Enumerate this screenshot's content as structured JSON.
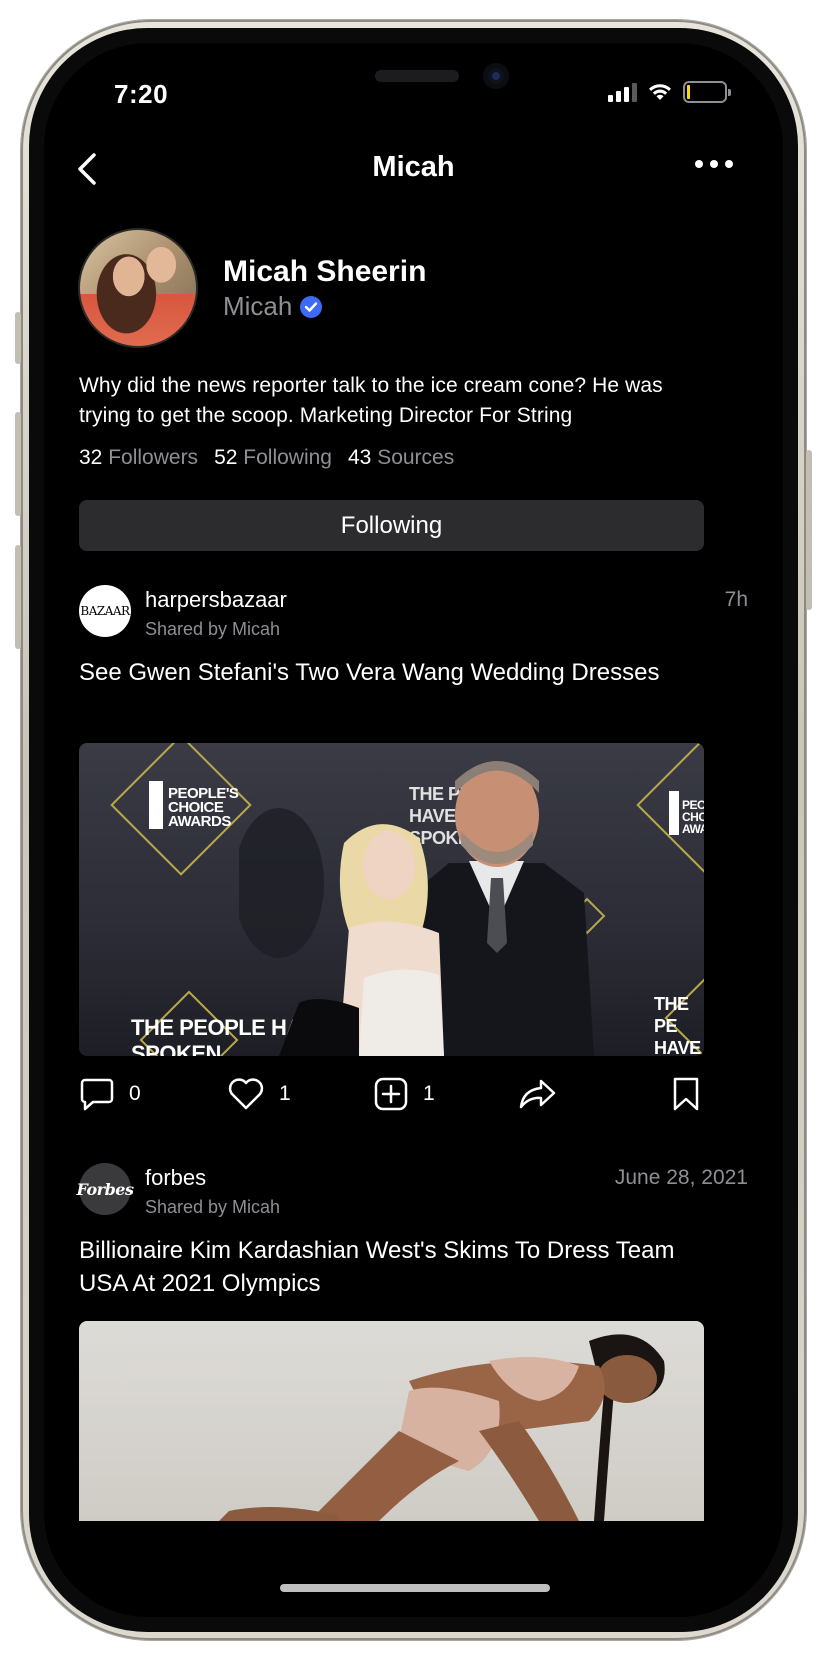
{
  "status_bar": {
    "time": "7:20"
  },
  "nav": {
    "title": "Micah"
  },
  "profile": {
    "name": "Micah Sheerin",
    "handle": "Micah",
    "bio": "Why did the news reporter talk to the ice cream cone? He was trying to get the scoop. Marketing Director For String",
    "stats": [
      {
        "count": "32",
        "label": "Followers"
      },
      {
        "count": "52",
        "label": "Following"
      },
      {
        "count": "43",
        "label": "Sources"
      }
    ],
    "follow_button": "Following"
  },
  "posts": [
    {
      "source": "harpersbazaar",
      "logo_text": "BAZAAR",
      "shared_by": "Shared by Micah",
      "time": "7h",
      "title": "See Gwen Stefani's Two Vera Wang Wedding Dresses",
      "image_texts": {
        "pca_left": "PEOPLE'S CHOICE AWARDS",
        "pca_right": "PEOPL CHOIC AWAR",
        "banner_bottom_left": "THE PEOPLE HAVE SPOKEN",
        "banner_bottom_right": "THE PE HAVE SP",
        "banner_top": "THE PE HAVE SPOKEN"
      },
      "comments": "0",
      "likes": "1",
      "adds": "1"
    },
    {
      "source": "forbes",
      "logo_text": "Forbes",
      "shared_by": "Shared by Micah",
      "time": "June 28, 2021",
      "title": "Billionaire Kim Kardashian West's Skims To Dress Team USA At 2021 Olympics"
    }
  ],
  "colors": {
    "background": "#000000",
    "secondary_text": "#8e8e93",
    "button_bg": "#2c2c2e",
    "verified": "#3d6bf5",
    "award_gold": "#b8a94a"
  }
}
